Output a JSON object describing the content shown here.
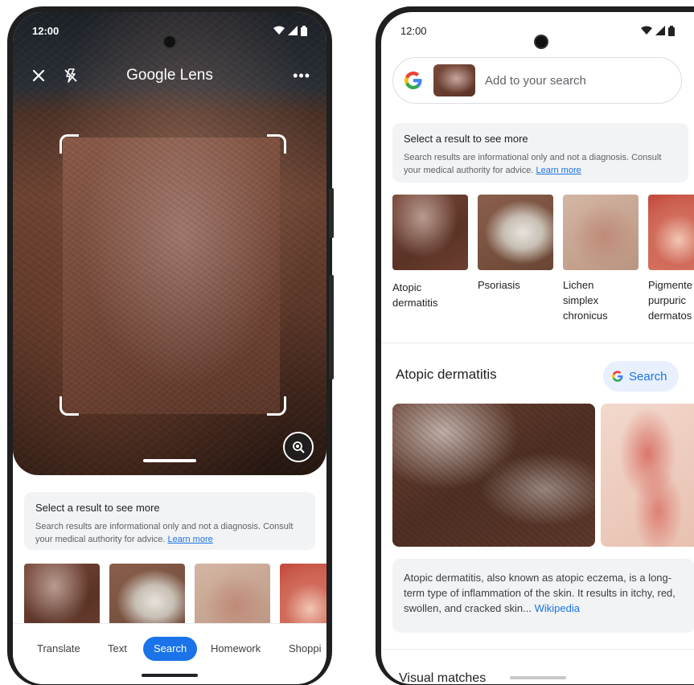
{
  "left_phone": {
    "status": {
      "time": "12:00"
    },
    "lens_title": "Google Lens",
    "info_card": {
      "heading": "Select a result to see more",
      "body": "Search results are informational only and not a diagnosis. Consult your medical authority for advice.",
      "link": "Learn more"
    },
    "modes": [
      "Translate",
      "Text",
      "Search",
      "Homework",
      "Shoppi"
    ],
    "active_mode": "Search"
  },
  "right_phone": {
    "status": {
      "time": "12:00"
    },
    "search_placeholder": "Add to your search",
    "info_card": {
      "heading": "Select a result to see more",
      "body": "Search results are informational only and not a diagnosis. Consult your medical authority for advice.",
      "link": "Learn more"
    },
    "results": [
      {
        "label": "Atopic dermatitis"
      },
      {
        "label": "Psoriasis"
      },
      {
        "label": "Lichen simplex chronicus"
      },
      {
        "label": "Pigmente purpuric dermatos"
      }
    ],
    "topic": {
      "title": "Atopic dermatitis",
      "search_label": "Search",
      "description": "Atopic dermatitis, also known as atopic eczema, is a long-term type of inflammation of the skin. It results in itchy, red, swollen, and cracked skin...",
      "source": "Wikipedia"
    },
    "visual_matches_label": "Visual matches"
  },
  "colors": {
    "accent": "#1a73e8",
    "card_bg": "#f1f3f4",
    "phone_frame": "#1f1f1f"
  }
}
